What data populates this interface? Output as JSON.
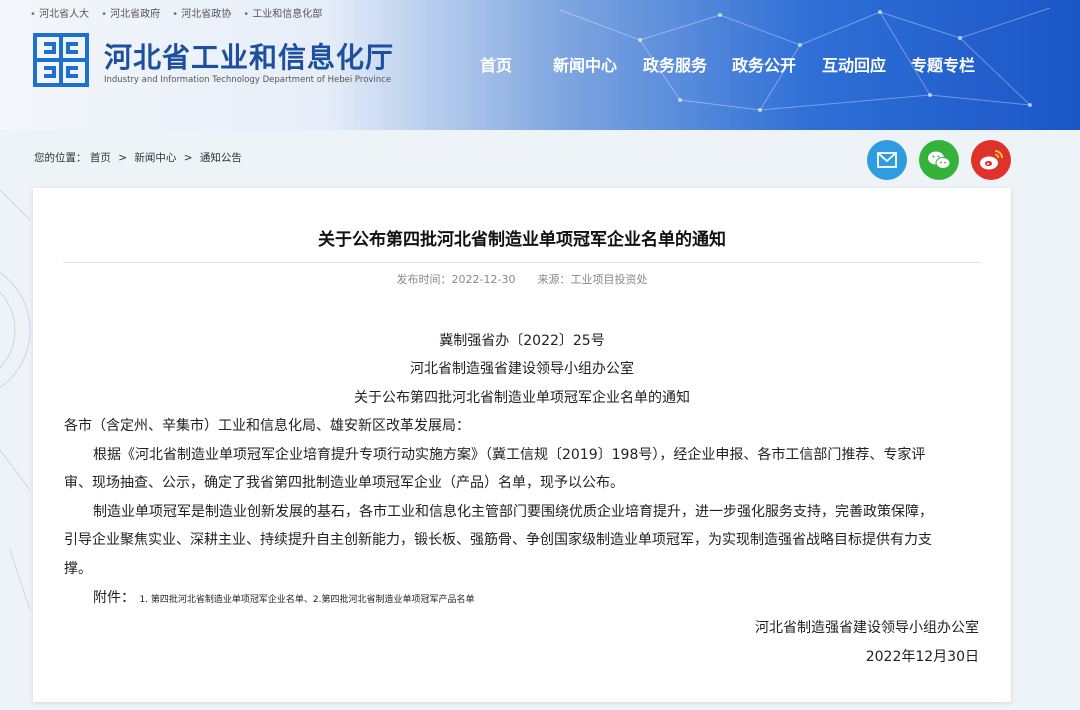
{
  "header": {
    "top_links": [
      "河北省人大",
      "河北省政府",
      "河北省政协",
      "工业和信息化部"
    ],
    "site_title": "河北省工业和信息化厅",
    "site_subtitle": "Industry and Information Technology Department of Hebei Province",
    "nav": [
      "首页",
      "新闻中心",
      "政务服务",
      "政务公开",
      "互动回应",
      "专题专栏"
    ]
  },
  "breadcrumb": {
    "prefix": "您的位置：",
    "items": [
      "首页",
      "新闻中心",
      "通知公告"
    ],
    "separator": ">"
  },
  "share": {
    "icons": [
      "email-icon",
      "wechat-icon",
      "weibo-icon"
    ],
    "colors": {
      "email": "#2f9be0",
      "wechat": "#35b23a",
      "weibo": "#e0322c"
    }
  },
  "article": {
    "title": "关于公布第四批河北省制造业单项冠军企业名单的通知",
    "publish_label": "发布时间：",
    "publish_date": "2022-12-30",
    "source_label": "来源：",
    "source": "工业项目投资处",
    "doc_number": "冀制强省办〔2022〕25号",
    "issuer": "河北省制造强省建设领导小组办公室",
    "heading": "关于公布第四批河北省制造业单项冠军企业名单的通知",
    "salutation": "各市（含定州、辛集市）工业和信息化局、雄安新区改革发展局：",
    "p1_line1": "根据《河北省制造业单项冠军企业培育提升专项行动实施方案》（冀工信规〔2019〕198号），经企业申报、各市工信部门推荐、专家评",
    "p1_line2": "审、现场抽查、公示，确定了我省第四批制造业单项冠军企业（产品）名单，现予以公布。",
    "p2_line1": "制造业单项冠军是制造业创新发展的基石，各市工业和信息化主管部门要围绕优质企业培育提升，进一步强化服务支持，完善政策保障，",
    "p2_line2": "引导企业聚焦实业、深耕主业、持续提升自主创新能力，锻长板、强筋骨、争创国家级制造业单项冠军，为实现制造强省战略目标提供有力支",
    "p2_line3": "撑。",
    "attachment_label": "附件：",
    "attachment_list": "1. 第四批河北省制造业单项冠军企业名单、2.第四批河北省制造业单项冠军产品名单",
    "signature": "河北省制造强省建设领导小组办公室",
    "sign_date": "2022年12月30日"
  },
  "colors": {
    "title_blue": "#1d4f9e",
    "header_blue": "#1b56c7"
  }
}
